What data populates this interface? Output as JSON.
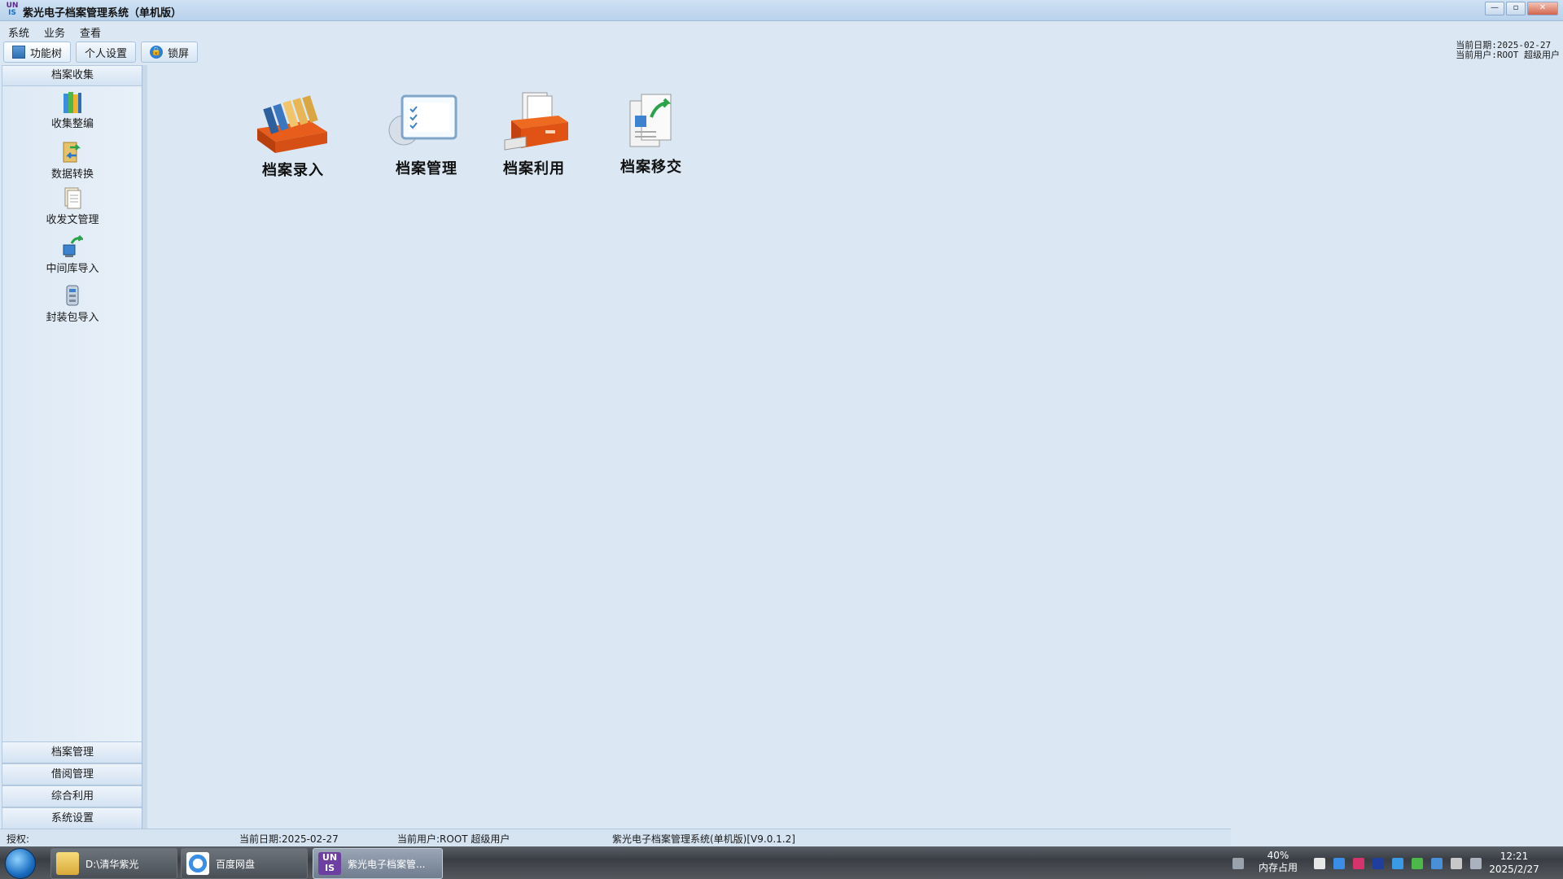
{
  "window": {
    "title": "紫光电子档案管理系统（单机版）",
    "logo_line1": "UN",
    "logo_line2": "IS",
    "controls": {
      "minimize": "—",
      "maximize": "▫",
      "close": "✕"
    }
  },
  "menu": [
    "系统",
    "业务",
    "查看"
  ],
  "toolbar": {
    "function_tree": "功能树",
    "personal_settings": "个人设置",
    "lock_screen": "锁屏"
  },
  "top_info": {
    "date": "当前日期:2025-02-27",
    "user": "当前用户:ROOT 超级用户"
  },
  "sidebar": {
    "top_group": "档案收集",
    "items": [
      {
        "label": "收集整编",
        "icon": "books-icon"
      },
      {
        "label": "数据转换",
        "icon": "data-convert-icon"
      },
      {
        "label": "收发文管理",
        "icon": "documents-icon"
      },
      {
        "label": "中间库导入",
        "icon": "db-import-icon"
      },
      {
        "label": "封装包导入",
        "icon": "package-import-icon"
      }
    ],
    "bottom_groups": [
      "档案管理",
      "借阅管理",
      "综合利用",
      "系统设置"
    ]
  },
  "main_tiles": [
    {
      "label": "档案录入",
      "icon": "archive-box-icon"
    },
    {
      "label": "档案管理",
      "icon": "checklist-monitor-icon"
    },
    {
      "label": "档案利用",
      "icon": "file-drawer-icon"
    },
    {
      "label": "档案移交",
      "icon": "transfer-document-icon"
    }
  ],
  "statusbar": {
    "auth": "授权:",
    "date": "当前日期:2025-02-27",
    "user": "当前用户:ROOT 超级用户",
    "version": "紫光电子档案管理系统(单机版)[V9.0.1.2]"
  },
  "taskbar": {
    "items": [
      {
        "label": "D:\\清华紫光",
        "icon": "folder-icon"
      },
      {
        "label": "百度网盘",
        "icon": "baidu-netdisk-icon"
      },
      {
        "label": "紫光电子档案管...",
        "icon": "unis-app-icon"
      }
    ],
    "memory_percent": "40%",
    "memory_label": "内存占用",
    "time": "12:21",
    "date": "2025/2/27"
  },
  "colors": {
    "background": "#dbe8f4",
    "accent": "#2f7fd3"
  }
}
